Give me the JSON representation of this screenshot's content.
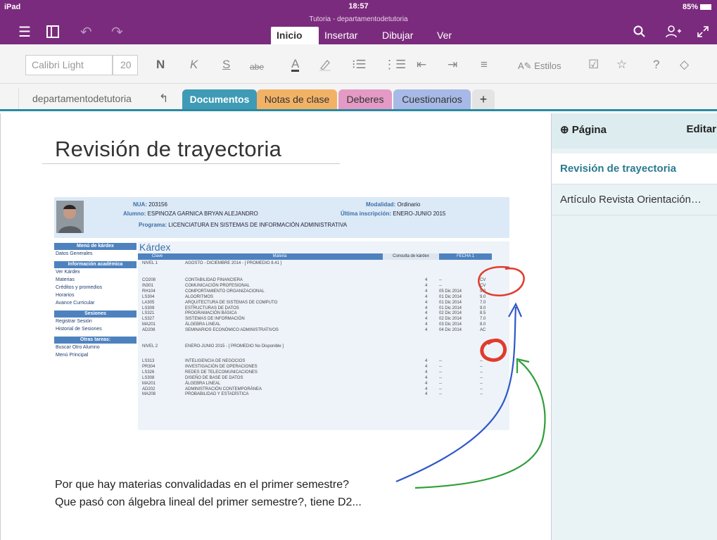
{
  "status": {
    "device": "iPad",
    "time": "18:57",
    "battery": "85%"
  },
  "app": {
    "doc_title": "Tutoria - departamentodetutoria"
  },
  "ribbon_tabs": [
    {
      "label": "Inicio",
      "active": true
    },
    {
      "label": "Insertar",
      "active": false
    },
    {
      "label": "Dibujar",
      "active": false
    },
    {
      "label": "Ver",
      "active": false
    }
  ],
  "toolbar": {
    "font_name": "Calibri Light",
    "font_size": "20",
    "bold": "N",
    "italic": "K",
    "underline": "S",
    "strike": "abe",
    "font_color": "A",
    "styles_label": "Estilos"
  },
  "notebook": {
    "name": "departamentodetutoria"
  },
  "section_tabs": [
    {
      "label": "Documentos",
      "color": "#3f9bb5",
      "active": true
    },
    {
      "label": "Notas de clase",
      "color": "#f2b266",
      "active": false
    },
    {
      "label": "Deberes",
      "color": "#e39ac4",
      "active": false
    },
    {
      "label": "Cuestionarios",
      "color": "#a7b9e6",
      "active": false
    }
  ],
  "add_section": "+",
  "page": {
    "title": "Revisión de trayectoria"
  },
  "pages_panel": {
    "add_label": "Página",
    "edit_label": "Editar",
    "pages": [
      {
        "title": "Revisión de trayectoria",
        "selected": true
      },
      {
        "title": "Artículo Revista Orientación…",
        "selected": false
      }
    ]
  },
  "kardex": {
    "nua_label": "NUA:",
    "nua": "203156",
    "alumno_label": "Alumno:",
    "alumno": "ESPINOZA GARNICA BRYAN ALEJANDRO",
    "programa_label": "Programa:",
    "programa": "LICENCIATURA EN SISTEMAS DE INFORMACIÓN ADMINISTRATIVA",
    "modalidad_label": "Modalidad:",
    "modalidad": "Ordinario",
    "ultima_label": "Última inscripción:",
    "ultima": "ENERO-JUNIO 2015",
    "title": "Kárdex",
    "menu": [
      {
        "type": "head",
        "text": "Menú de kárdex"
      },
      {
        "type": "item",
        "text": "Datos Generales"
      },
      {
        "type": "head",
        "text": "Información académica"
      },
      {
        "type": "item",
        "text": "Ver Kárdex"
      },
      {
        "type": "item",
        "text": "Materias"
      },
      {
        "type": "item",
        "text": "Créditos y promedios"
      },
      {
        "type": "item",
        "text": "Horarios"
      },
      {
        "type": "item",
        "text": "Avance Curricular"
      },
      {
        "type": "head",
        "text": "Sesiones"
      },
      {
        "type": "item",
        "text": "Registrar Sesión"
      },
      {
        "type": "item",
        "text": "Historial de Sesiones"
      },
      {
        "type": "head",
        "text": "Otras tareas:"
      },
      {
        "type": "item",
        "text": "Buscar Otro Alumno"
      },
      {
        "type": "item",
        "text": "Menú Principal"
      }
    ],
    "columns": [
      "Clave",
      "Materia",
      "Consulta de kárdex",
      "FECHA 1"
    ],
    "levels": [
      {
        "label": "NIVEL 1",
        "text": "AGOSTO - DICIEMBRE 2014 - [ PROMEDIO 8.41 ]"
      },
      {
        "label": "NIVEL 2",
        "text": "ENERO-JUNIO 2015 - [ PROMEDIO No Disponible ]"
      }
    ],
    "rows1": [
      [
        "CO208",
        "CONTABILIDAD FINANCIERA",
        "4",
        "--",
        "CV"
      ],
      [
        "IN301",
        "COMUNICACIÓN PROFESIONAL",
        "4",
        "--",
        "CV"
      ],
      [
        "RH104",
        "COMPORTAMIENTO ORGANIZACIONAL",
        "4",
        "05 Dic 2014",
        "9.0"
      ],
      [
        "LS304",
        "ALGORITMOS",
        "4",
        "01 Dic 2014",
        "9.0"
      ],
      [
        "LA305",
        "ARQUITECTURA DE SISTEMAS DE COMPUTO",
        "4",
        "01 Dic 2014",
        "7.0"
      ],
      [
        "LS309",
        "ESTRUCTURAS DE DATOS",
        "4",
        "01 Dic 2014",
        "9.0"
      ],
      [
        "LS321",
        "PROGRAMACIÓN BÁSICA",
        "4",
        "02 Dic 2014",
        "8.5"
      ],
      [
        "LS327",
        "SISTEMAS DE INFORMACIÓN",
        "4",
        "02 Dic 2014",
        "7.0"
      ],
      [
        "MA201",
        "ÁLGEBRA LINEAL",
        "4",
        "03 Dic 2014",
        "8.0"
      ],
      [
        "AD208",
        "SEMINARIOS ECONÓMICO ADMINISTRATIVOS",
        "4",
        "04 Dic 2014",
        "AC"
      ]
    ],
    "rows2": [
      [
        "LS313",
        "INTELIGENCIA DE NEGOCIOS",
        "4",
        "--",
        "--"
      ],
      [
        "PR304",
        "INVESTIGACIÓN DE OPERACIONES",
        "4",
        "--",
        "--"
      ],
      [
        "LS326",
        "REDES DE TELECOMUNICACIONES",
        "4",
        "--",
        "--"
      ],
      [
        "LS308",
        "DISEÑO DE BASE DE DATOS",
        "4",
        "--",
        "--"
      ],
      [
        "MA201",
        "ÁLGEBRA LINEAL",
        "4",
        "--",
        "--"
      ],
      [
        "AD202",
        "ADMINISTRACIÓN CONTEMPORÁNEA",
        "4",
        "--",
        "--"
      ],
      [
        "MA208",
        "PROBABILIDAD Y ESTADÍSTICA",
        "4",
        "--",
        "--"
      ]
    ]
  },
  "notes": [
    "Por que hay materias convalidadas en el primer semestre?",
    "Que pasó con álgebra lineal del primer semestre?, tiene D2..."
  ],
  "colors": {
    "ribbon": "#7b2b7d",
    "accent": "#2b8aa0",
    "ink_red": "#e03b2d",
    "ink_blue": "#2f59c8",
    "ink_green": "#2e9e3a"
  }
}
